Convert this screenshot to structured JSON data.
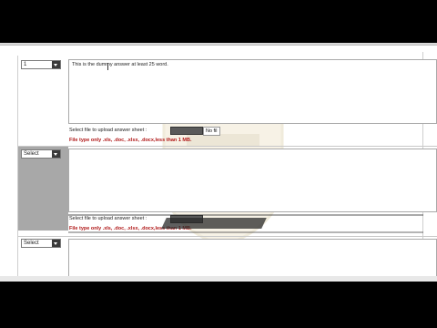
{
  "questions": [
    {
      "select_value": "1",
      "answer_text": "This is the dummy answer at least 25 word.",
      "upload_label": "Select file to upload answer sheet :",
      "file_status": "No fil",
      "file_note": "File type only .xls, .doc, .xlsx, .docx,less than 1 MB."
    },
    {
      "select_value": "Select",
      "answer_text": "",
      "upload_label": "Select file to upload answer sheet :",
      "file_note": "File type only .xls, .doc, .xlsx, .docx,less than 1 MB."
    },
    {
      "select_value": "Select",
      "answer_text": ""
    }
  ],
  "colors": {
    "note_red": "#b01818",
    "background": "#ffffff",
    "border_grey": "#a9a9a9"
  },
  "icons": [
    "dropdown-arrow-icon",
    "watermark-logo"
  ]
}
